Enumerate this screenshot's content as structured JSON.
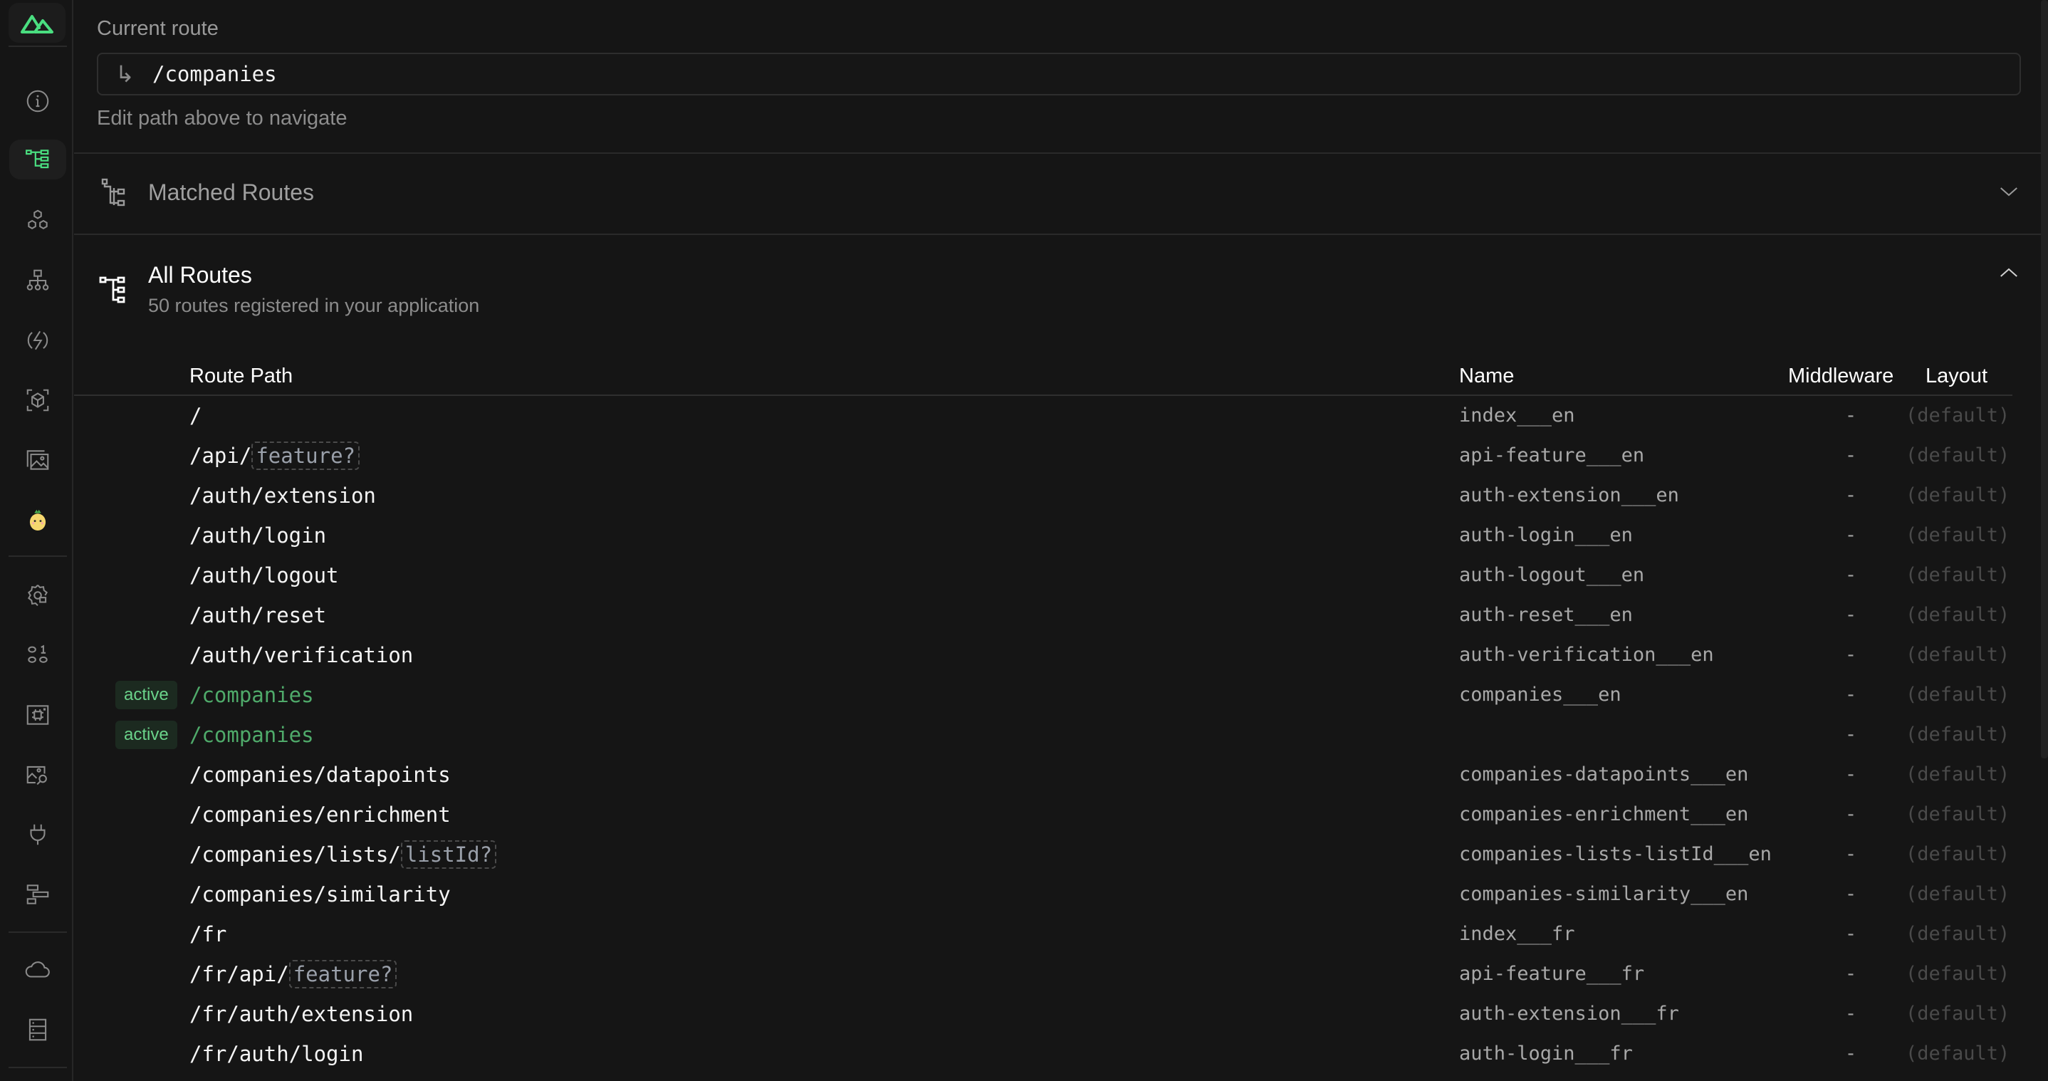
{
  "sidebar": {
    "logo": "nuxt-logo",
    "items": [
      {
        "icon": "info-icon",
        "label": "Overview"
      },
      {
        "icon": "route-tree-icon",
        "label": "Pages",
        "active": true
      },
      {
        "icon": "components-icon",
        "label": "Components"
      },
      {
        "icon": "sitemap-icon",
        "label": "Imports"
      },
      {
        "icon": "bolt-icon",
        "label": "Modules"
      },
      {
        "icon": "cube-scan-icon",
        "label": "Assets"
      },
      {
        "icon": "image-gallery-icon",
        "label": "Images"
      },
      {
        "icon": "pinia-icon",
        "label": "Pinia"
      },
      {
        "icon": "settings-icon",
        "label": "Runtime Config"
      },
      {
        "icon": "binary-icon",
        "label": "Payload"
      },
      {
        "icon": "chip-icon",
        "label": "Virtual Files"
      },
      {
        "icon": "image-search-icon",
        "label": "Inspect"
      },
      {
        "icon": "plug-icon",
        "label": "Hooks"
      },
      {
        "icon": "timeline-icon",
        "label": "Timeline"
      },
      {
        "icon": "cloud-icon",
        "label": "Server Routes"
      },
      {
        "icon": "storage-icon",
        "label": "Storage"
      }
    ]
  },
  "current_route": {
    "label": "Current route",
    "value": "/companies",
    "hint": "Edit path above to navigate"
  },
  "matched_routes": {
    "title": "Matched Routes",
    "expanded": false
  },
  "all_routes": {
    "title": "All Routes",
    "subtitle": "50 routes registered in your application",
    "expanded": true,
    "columns": {
      "path": "Route Path",
      "name": "Name",
      "middleware": "Middleware",
      "layout": "Layout"
    },
    "active_badge": "active",
    "rows": [
      {
        "path": "/",
        "param": "",
        "name": "index___en",
        "middleware": "-",
        "layout": "(default)",
        "active": false
      },
      {
        "path": "/api/",
        "param": "feature?",
        "name": "api-feature___en",
        "middleware": "-",
        "layout": "(default)",
        "active": false
      },
      {
        "path": "/auth/extension",
        "param": "",
        "name": "auth-extension___en",
        "middleware": "-",
        "layout": "(default)",
        "active": false
      },
      {
        "path": "/auth/login",
        "param": "",
        "name": "auth-login___en",
        "middleware": "-",
        "layout": "(default)",
        "active": false
      },
      {
        "path": "/auth/logout",
        "param": "",
        "name": "auth-logout___en",
        "middleware": "-",
        "layout": "(default)",
        "active": false
      },
      {
        "path": "/auth/reset",
        "param": "",
        "name": "auth-reset___en",
        "middleware": "-",
        "layout": "(default)",
        "active": false
      },
      {
        "path": "/auth/verification",
        "param": "",
        "name": "auth-verification___en",
        "middleware": "-",
        "layout": "(default)",
        "active": false
      },
      {
        "path": "/companies",
        "param": "",
        "name": "companies___en",
        "middleware": "-",
        "layout": "(default)",
        "active": true
      },
      {
        "path": "/companies",
        "param": "",
        "name": "",
        "middleware": "-",
        "layout": "(default)",
        "active": true
      },
      {
        "path": "/companies/datapoints",
        "param": "",
        "name": "companies-datapoints___en",
        "middleware": "-",
        "layout": "(default)",
        "active": false
      },
      {
        "path": "/companies/enrichment",
        "param": "",
        "name": "companies-enrichment___en",
        "middleware": "-",
        "layout": "(default)",
        "active": false
      },
      {
        "path": "/companies/lists/",
        "param": "listId?",
        "name": "companies-lists-listId___en",
        "middleware": "-",
        "layout": "(default)",
        "active": false
      },
      {
        "path": "/companies/similarity",
        "param": "",
        "name": "companies-similarity___en",
        "middleware": "-",
        "layout": "(default)",
        "active": false
      },
      {
        "path": "/fr",
        "param": "",
        "name": "index___fr",
        "middleware": "-",
        "layout": "(default)",
        "active": false
      },
      {
        "path": "/fr/api/",
        "param": "feature?",
        "name": "api-feature___fr",
        "middleware": "-",
        "layout": "(default)",
        "active": false
      },
      {
        "path": "/fr/auth/extension",
        "param": "",
        "name": "auth-extension___fr",
        "middleware": "-",
        "layout": "(default)",
        "active": false
      },
      {
        "path": "/fr/auth/login",
        "param": "",
        "name": "auth-login___fr",
        "middleware": "-",
        "layout": "(default)",
        "active": false
      }
    ]
  },
  "colors": {
    "accent": "#4faa6a",
    "badge_bg": "#1c2a20",
    "badge_text": "#6ad38a",
    "background": "#151515"
  }
}
